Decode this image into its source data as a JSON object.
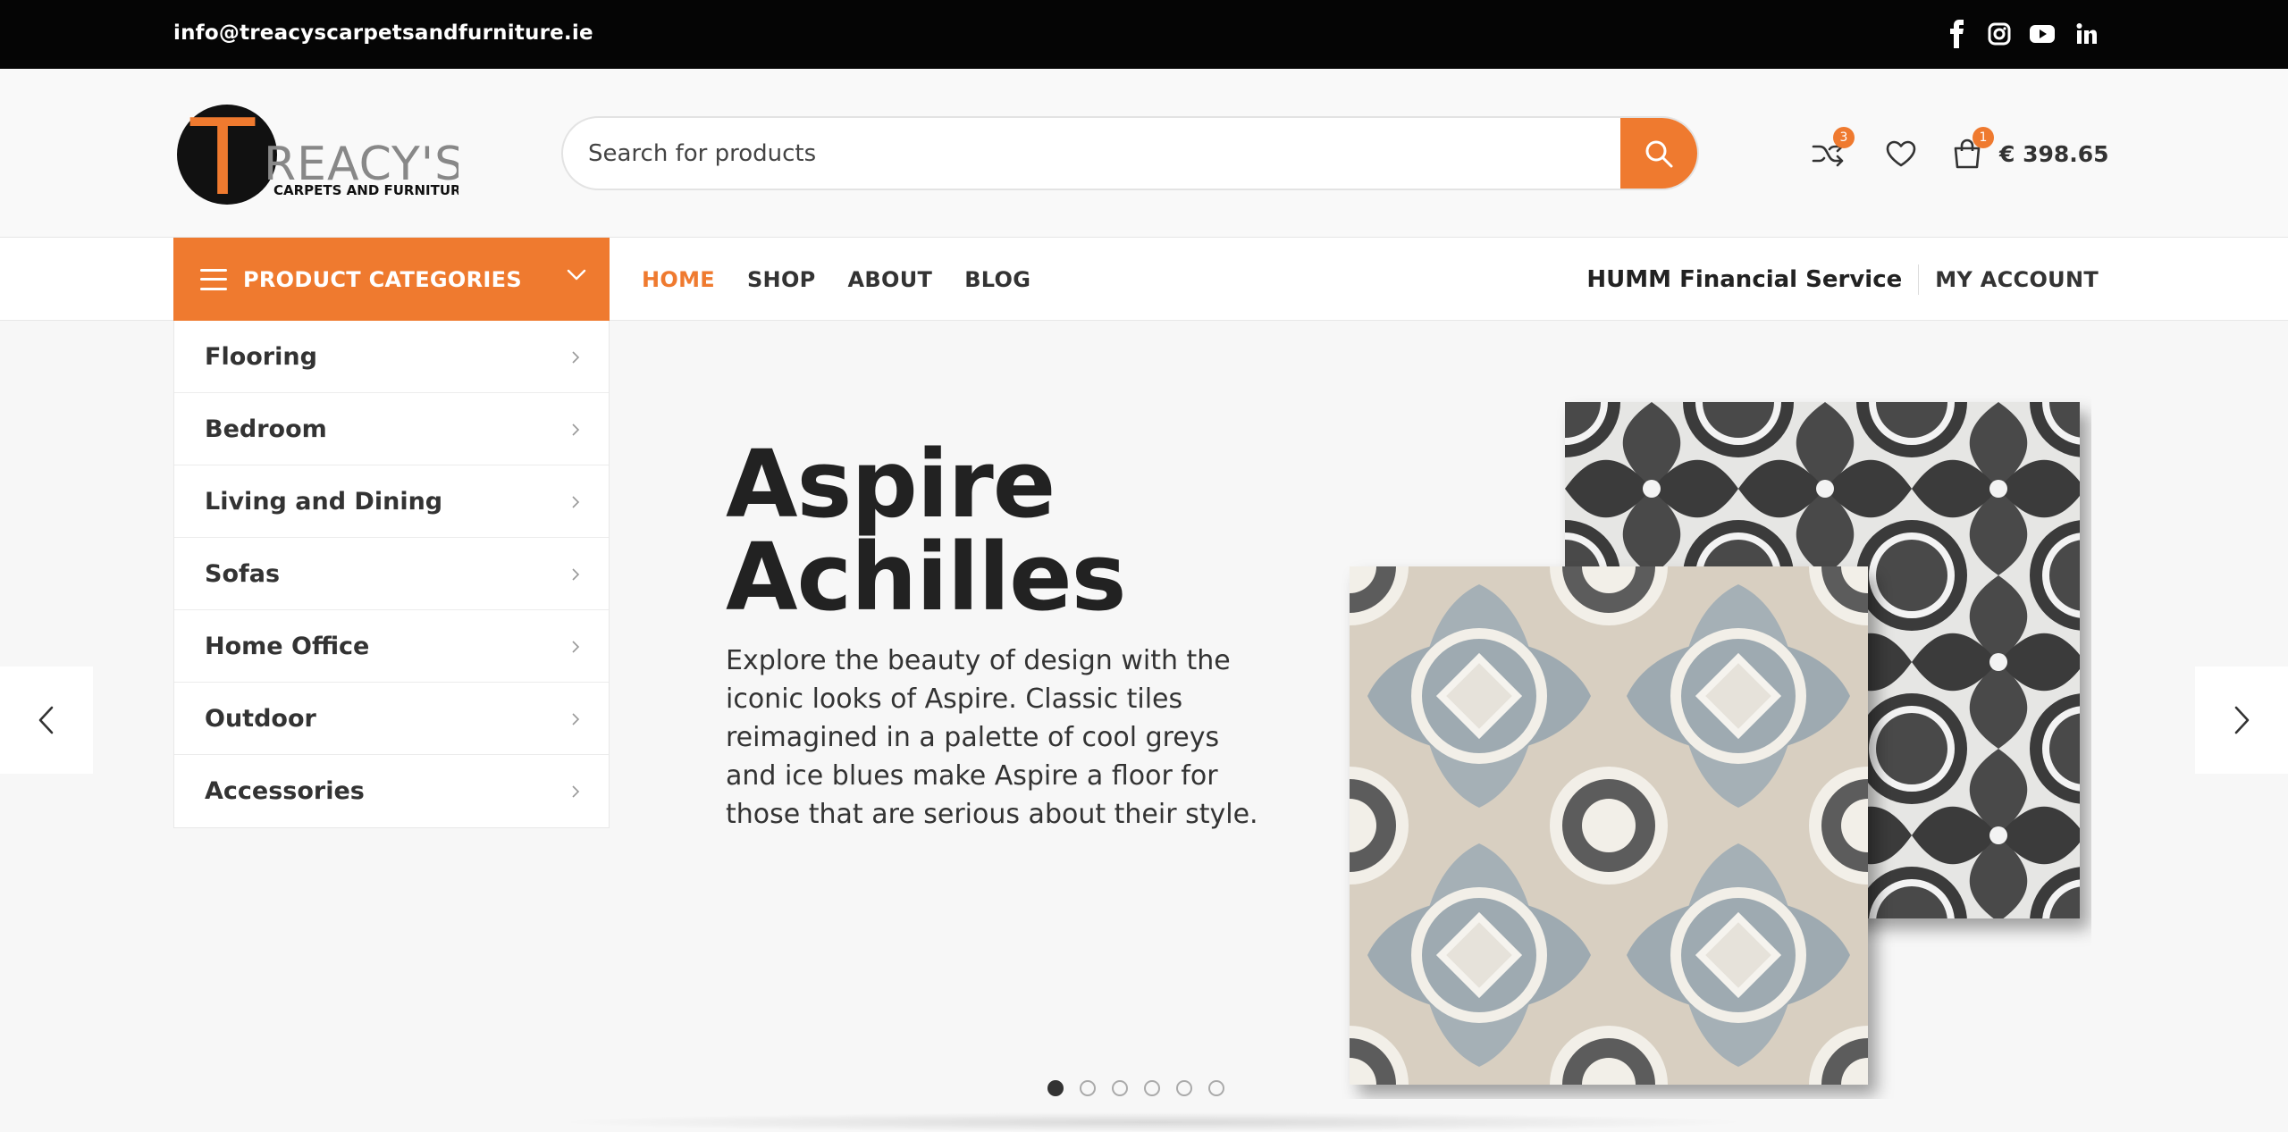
{
  "topbar": {
    "email": "info@treacyscarpetsandfurniture.ie",
    "social": [
      "facebook-icon",
      "instagram-icon",
      "youtube-icon",
      "linkedin-icon"
    ]
  },
  "logo": {
    "letter": "T",
    "rest": "REACY'S",
    "tagline": "CARPETS AND FURNITURE"
  },
  "search": {
    "placeholder": "Search for products"
  },
  "header_icons": {
    "compare_count": "3",
    "cart_count": "1",
    "cart_total": "€ 398.65"
  },
  "nav": {
    "categories_label": "PRODUCT CATEGORIES",
    "main": [
      {
        "label": "HOME",
        "active": true
      },
      {
        "label": "SHOP",
        "active": false
      },
      {
        "label": "ABOUT",
        "active": false
      },
      {
        "label": "BLOG",
        "active": false
      }
    ],
    "humm": "HUMM Financial Service",
    "account": "MY ACCOUNT"
  },
  "categories": [
    {
      "label": "Flooring"
    },
    {
      "label": "Bedroom"
    },
    {
      "label": "Living and Dining"
    },
    {
      "label": "Sofas"
    },
    {
      "label": "Home Office"
    },
    {
      "label": "Outdoor"
    },
    {
      "label": "Accessories"
    }
  ],
  "hero": {
    "title_line1": "Aspire",
    "title_line2": "Achilles",
    "text": "Explore the beauty of design with the iconic looks of Aspire. Classic tiles reimagined in a palette of cool greys and ice blues make Aspire a floor for those that are serious about their style.",
    "slides": 6,
    "active_slide": 1
  },
  "colors": {
    "accent": "#ef7a2f",
    "topbar": "#050505"
  }
}
